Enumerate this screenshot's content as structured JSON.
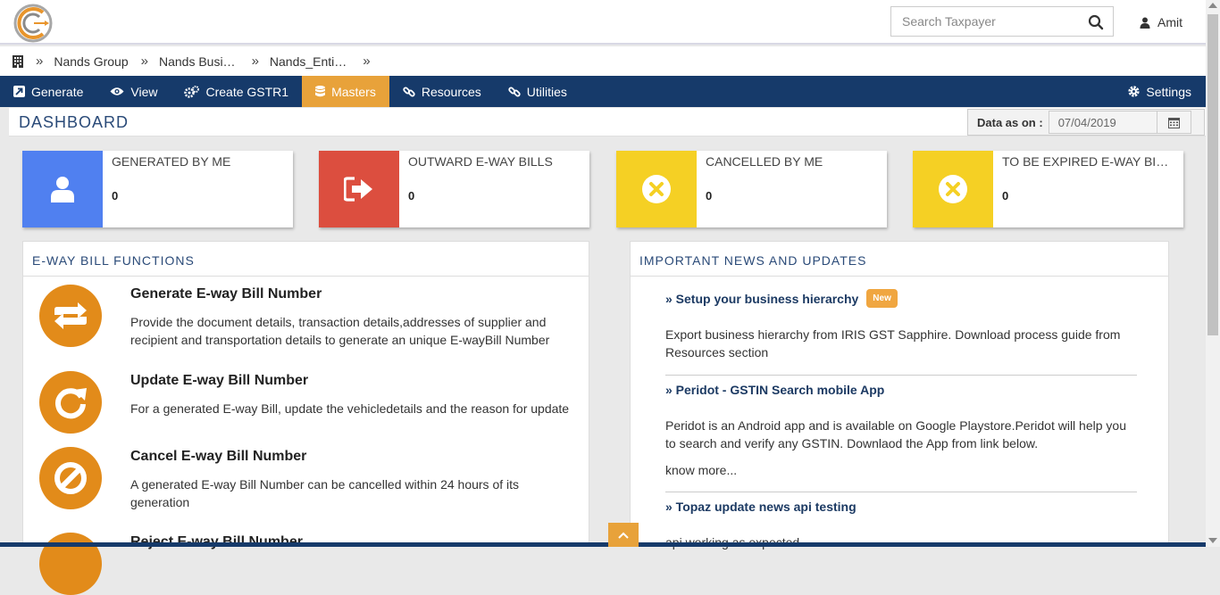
{
  "header": {
    "search": {
      "placeholder": "Search Taxpayer"
    },
    "user": {
      "name": "Amit"
    }
  },
  "breadcrumb": [
    "Nands Group",
    "Nands Busi…",
    "Nands_Enti…"
  ],
  "nav": {
    "items": [
      {
        "label": "Generate",
        "icon": "external-link-icon"
      },
      {
        "label": "View",
        "icon": "eye-icon"
      },
      {
        "label": "Create GSTR1",
        "icon": "gears-icon"
      },
      {
        "label": "Masters",
        "icon": "database-icon",
        "active": true
      },
      {
        "label": "Resources",
        "icon": "link-icon"
      },
      {
        "label": "Utilities",
        "icon": "link-icon"
      }
    ],
    "settings": "Settings"
  },
  "dashboard": {
    "title": "DASHBOARD",
    "data_as_on_label": "Data as on :",
    "data_as_on_value": "07/04/2019"
  },
  "stats": [
    {
      "label": "GENERATED BY ME",
      "value": "0",
      "color": "#5080f0",
      "icon": "user-icon"
    },
    {
      "label": "OUTWARD E-WAY BILLS",
      "value": "0",
      "color": "#dc4e3f",
      "icon": "sign-out-icon"
    },
    {
      "label": "CANCELLED BY ME",
      "value": "0",
      "color": "#f5d024",
      "icon": "times-circle-icon"
    },
    {
      "label": "TO BE EXPIRED E-WAY BI…",
      "value": "0",
      "color": "#f5d024",
      "icon": "times-circle-icon"
    }
  ],
  "functions": {
    "heading": "E-WAY BILL FUNCTIONS",
    "items": [
      {
        "title": "Generate E-way Bill Number",
        "desc": "Provide the document details, transaction details,addresses of supplier and recipient and transportation details to generate an unique E-wayBill Number",
        "icon": "retweet-icon"
      },
      {
        "title": "Update E-way Bill Number",
        "desc": "For a generated E-way Bill, update the vehicledetails and the reason for update",
        "icon": "refresh-icon"
      },
      {
        "title": "Cancel E-way Bill Number",
        "desc": "A generated E-way Bill Number can be cancelled within 24 hours of its generation",
        "icon": "ban-icon"
      },
      {
        "title": "Reject E-way Bill Number",
        "desc": "",
        "icon": "reject-icon"
      }
    ]
  },
  "news": {
    "heading": "IMPORTANT NEWS AND UPDATES",
    "items": [
      {
        "title": "» Setup your business hierarchy",
        "badge": "New",
        "desc": "Export business hierarchy from IRIS GST Sapphire. Download process guide from Resources section"
      },
      {
        "title": "» Peridot - GSTIN Search mobile App",
        "desc": "Peridot is an Android app and is available on Google Playstore.Peridot will help you to search and verify any GSTIN. Downlaod the App from link below.",
        "more": "know more..."
      },
      {
        "title": "» Topaz update news api testing",
        "desc": "api working as expected"
      }
    ]
  },
  "colors": {
    "navy": "#163a6a",
    "orange": "#e8a23a",
    "func_orange": "#e28b1a"
  }
}
